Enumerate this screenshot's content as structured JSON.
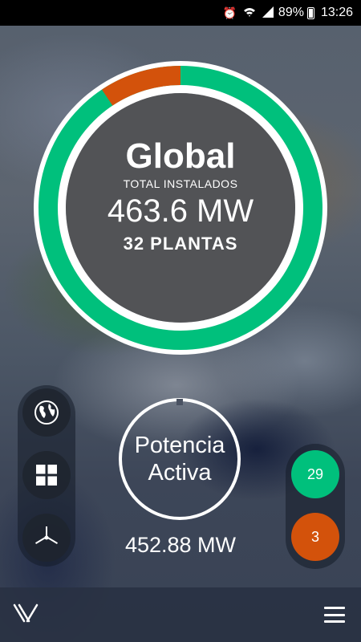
{
  "status_bar": {
    "battery": "89%",
    "time": "13:26",
    "icons": [
      "alarm-icon",
      "wifi-icon",
      "signal-icon",
      "battery-icon"
    ]
  },
  "main_gauge": {
    "title": "Global",
    "subtitle": "TOTAL INSTALADOS",
    "value": "463.6 MW",
    "plants": "32 PLANTAS",
    "green_count": 29,
    "orange_count": 3
  },
  "active_power": {
    "label_line1": "Potencia",
    "label_line2": "Activa",
    "value": "452.88 MW"
  },
  "left_nav": {
    "items": [
      "globe-icon",
      "grid-icon",
      "wind-turbine-icon"
    ]
  },
  "counters": {
    "green": "29",
    "orange": "3"
  },
  "bottom_bar": {
    "icons": [
      "logo-icon",
      "menu-icon"
    ]
  },
  "colors": {
    "green": "#00c07c",
    "orange": "#d3520b",
    "white": "#ffffff"
  }
}
